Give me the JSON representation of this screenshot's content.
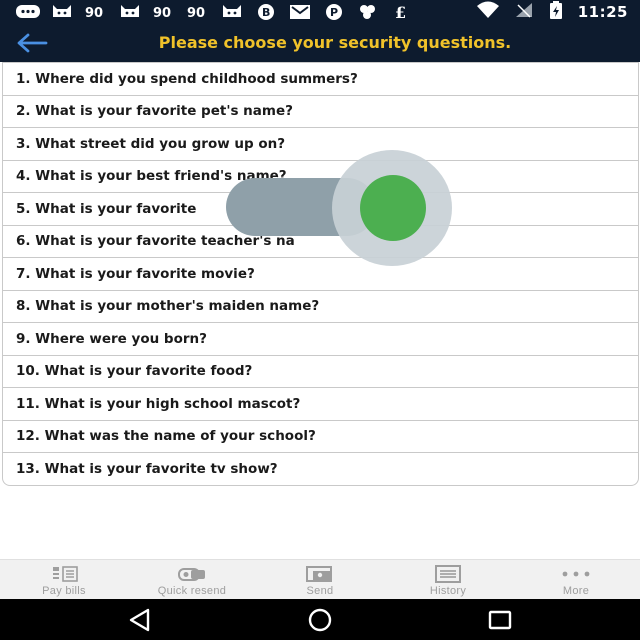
{
  "status_bar": {
    "time": "11:25",
    "left_icons": [
      "message-icon",
      "cat-icon",
      "infinity-icon",
      "cat-icon",
      "infinity-icon",
      "infinity-icon",
      "cat-icon",
      "b-icon",
      "mail-icon",
      "pinterest-icon",
      "cluster-icon",
      "e-icon"
    ],
    "right_icons": [
      "wifi-icon",
      "signal-icon",
      "battery-icon"
    ]
  },
  "header": {
    "title": "Please choose your security questions.",
    "title_color": "#f0c22a",
    "background": "#0d1b2e",
    "back_icon": "arrow-left-icon"
  },
  "questions": [
    "1. Where did you spend childhood summers?",
    "2. What is your favorite pet's name?",
    "3. What street did you grow up on?",
    "4. What is your best friend's name?",
    "5. What is your favorite",
    "6. What is your favorite teacher's na",
    "7. What is your favorite movie?",
    "8. What is your mother's maiden name?",
    "9. Where were you born?",
    "10. What is your favorite food?",
    "11. What is your high school mascot?",
    "12. What was the name of your school?",
    "13. What is your favorite tv show?"
  ],
  "toggle": {
    "state": "on",
    "accent": "#4caf50"
  },
  "bottom_nav": {
    "items": [
      {
        "label": "Pay bills",
        "icon": "bill-icon"
      },
      {
        "label": "Quick resend",
        "icon": "quick-resend-icon"
      },
      {
        "label": "Send",
        "icon": "send-icon"
      },
      {
        "label": "History",
        "icon": "history-icon"
      },
      {
        "label": "More",
        "icon": "more-dots-icon"
      }
    ]
  },
  "system_nav": [
    "back-triangle-icon",
    "home-circle-icon",
    "recents-square-icon"
  ]
}
